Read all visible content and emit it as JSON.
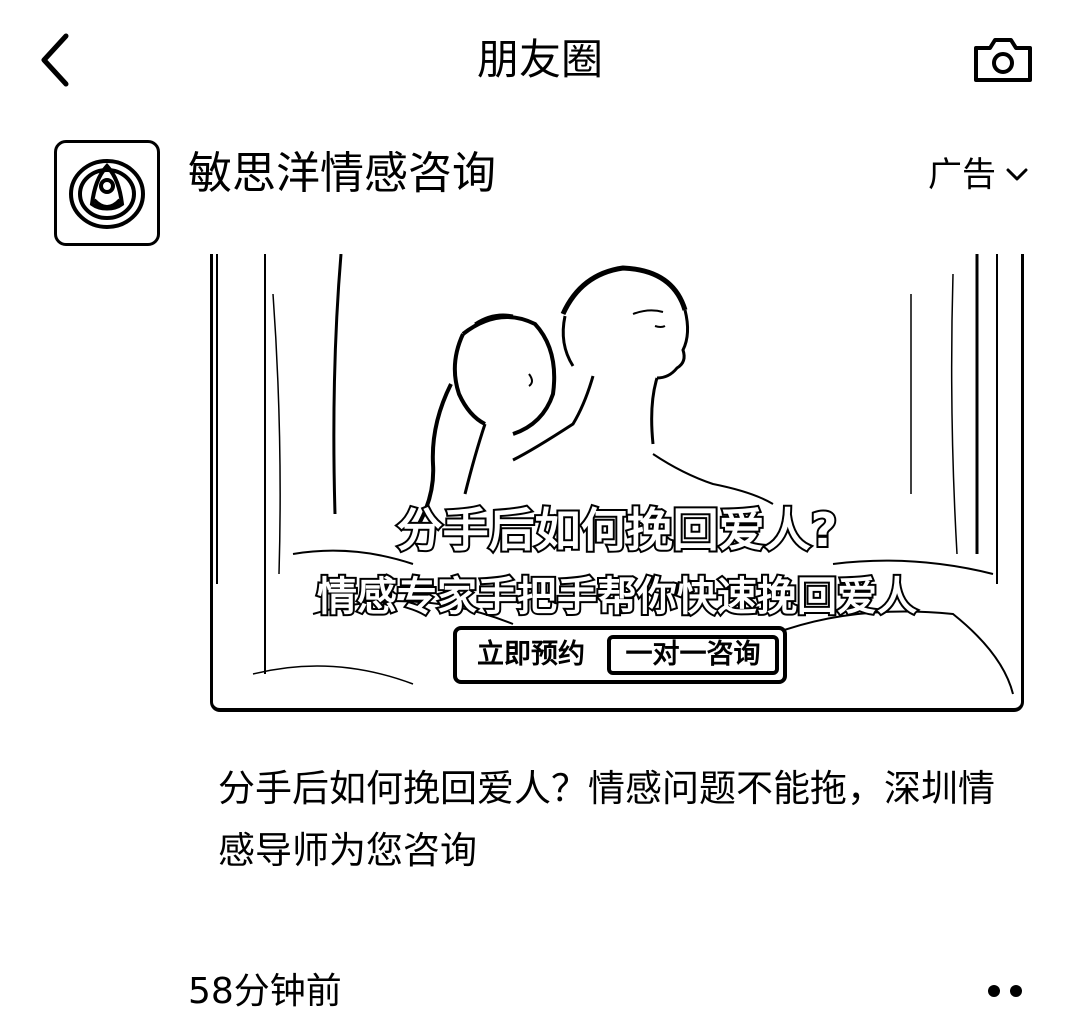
{
  "header": {
    "title": "朋友圈",
    "back_icon": "chevron-left-icon",
    "camera_icon": "camera-icon"
  },
  "post": {
    "author": "敏思洋情感咨询",
    "avatar_icon": "brand-logo",
    "ad_label": "广告",
    "ad_menu_icon": "chevron-down-icon",
    "image": {
      "headline_1": "分手后如何挽回爱人?",
      "headline_2": "情感专家手把手帮你快速挽回爱人",
      "cta_left": "立即预约",
      "cta_right": "一对一咨询"
    },
    "caption": "分手后如何挽回爱人？情感问题不能拖，深圳情感导师为您咨询",
    "timestamp": "58分钟前",
    "more_icon": "more-dots-icon"
  }
}
